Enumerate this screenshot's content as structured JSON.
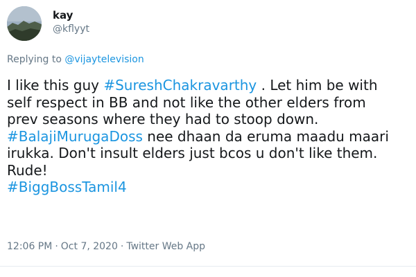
{
  "author": {
    "display_name": "kay",
    "handle": "@kflyyt"
  },
  "reply": {
    "prefix": "Replying to",
    "target": "@vijaytelevision"
  },
  "body": {
    "l1_a": "I like this guy ",
    "l1_tag": "#SureshChakravarthy",
    "l1_b": " . Let him be with",
    "l2": "self respect in BB and not like the other elders from",
    "l3": "prev seasons where they had to stoop down.",
    "l4_tag": "#BalajiMurugaDoss",
    "l4_b": " nee dhaan da eruma maadu maari",
    "l5": "irukka. Don't insult elders just bcos u don't like them.",
    "l6": "Rude!",
    "l7_tag": "#BiggBossTamil4"
  },
  "meta": {
    "time": "12:06 PM",
    "sep1": "·",
    "date": "Oct 7, 2020",
    "sep2": "·",
    "source": "Twitter Web App"
  },
  "colors": {
    "link": "#1b95e0",
    "text": "#14171a",
    "muted": "#657786"
  }
}
